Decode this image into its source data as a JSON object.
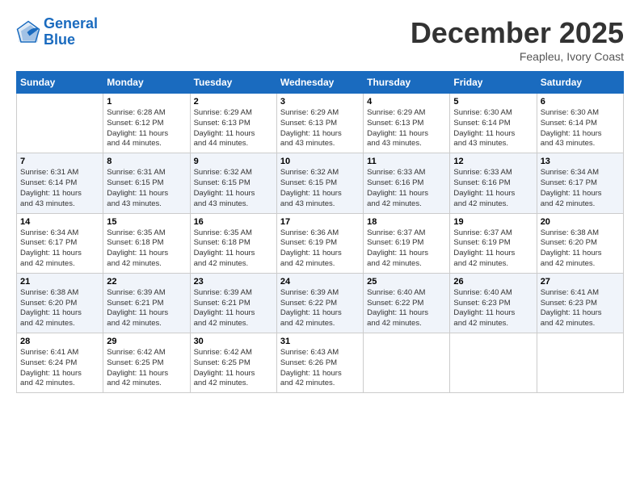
{
  "header": {
    "logo_line1": "General",
    "logo_line2": "Blue",
    "month": "December 2025",
    "location": "Feapleu, Ivory Coast"
  },
  "weekdays": [
    "Sunday",
    "Monday",
    "Tuesday",
    "Wednesday",
    "Thursday",
    "Friday",
    "Saturday"
  ],
  "weeks": [
    [
      {
        "day": "",
        "text": ""
      },
      {
        "day": "1",
        "text": "Sunrise: 6:28 AM\nSunset: 6:12 PM\nDaylight: 11 hours\nand 44 minutes."
      },
      {
        "day": "2",
        "text": "Sunrise: 6:29 AM\nSunset: 6:13 PM\nDaylight: 11 hours\nand 44 minutes."
      },
      {
        "day": "3",
        "text": "Sunrise: 6:29 AM\nSunset: 6:13 PM\nDaylight: 11 hours\nand 43 minutes."
      },
      {
        "day": "4",
        "text": "Sunrise: 6:29 AM\nSunset: 6:13 PM\nDaylight: 11 hours\nand 43 minutes."
      },
      {
        "day": "5",
        "text": "Sunrise: 6:30 AM\nSunset: 6:14 PM\nDaylight: 11 hours\nand 43 minutes."
      },
      {
        "day": "6",
        "text": "Sunrise: 6:30 AM\nSunset: 6:14 PM\nDaylight: 11 hours\nand 43 minutes."
      }
    ],
    [
      {
        "day": "7",
        "text": "Sunrise: 6:31 AM\nSunset: 6:14 PM\nDaylight: 11 hours\nand 43 minutes."
      },
      {
        "day": "8",
        "text": "Sunrise: 6:31 AM\nSunset: 6:15 PM\nDaylight: 11 hours\nand 43 minutes."
      },
      {
        "day": "9",
        "text": "Sunrise: 6:32 AM\nSunset: 6:15 PM\nDaylight: 11 hours\nand 43 minutes."
      },
      {
        "day": "10",
        "text": "Sunrise: 6:32 AM\nSunset: 6:15 PM\nDaylight: 11 hours\nand 43 minutes."
      },
      {
        "day": "11",
        "text": "Sunrise: 6:33 AM\nSunset: 6:16 PM\nDaylight: 11 hours\nand 42 minutes."
      },
      {
        "day": "12",
        "text": "Sunrise: 6:33 AM\nSunset: 6:16 PM\nDaylight: 11 hours\nand 42 minutes."
      },
      {
        "day": "13",
        "text": "Sunrise: 6:34 AM\nSunset: 6:17 PM\nDaylight: 11 hours\nand 42 minutes."
      }
    ],
    [
      {
        "day": "14",
        "text": "Sunrise: 6:34 AM\nSunset: 6:17 PM\nDaylight: 11 hours\nand 42 minutes."
      },
      {
        "day": "15",
        "text": "Sunrise: 6:35 AM\nSunset: 6:18 PM\nDaylight: 11 hours\nand 42 minutes."
      },
      {
        "day": "16",
        "text": "Sunrise: 6:35 AM\nSunset: 6:18 PM\nDaylight: 11 hours\nand 42 minutes."
      },
      {
        "day": "17",
        "text": "Sunrise: 6:36 AM\nSunset: 6:19 PM\nDaylight: 11 hours\nand 42 minutes."
      },
      {
        "day": "18",
        "text": "Sunrise: 6:37 AM\nSunset: 6:19 PM\nDaylight: 11 hours\nand 42 minutes."
      },
      {
        "day": "19",
        "text": "Sunrise: 6:37 AM\nSunset: 6:19 PM\nDaylight: 11 hours\nand 42 minutes."
      },
      {
        "day": "20",
        "text": "Sunrise: 6:38 AM\nSunset: 6:20 PM\nDaylight: 11 hours\nand 42 minutes."
      }
    ],
    [
      {
        "day": "21",
        "text": "Sunrise: 6:38 AM\nSunset: 6:20 PM\nDaylight: 11 hours\nand 42 minutes."
      },
      {
        "day": "22",
        "text": "Sunrise: 6:39 AM\nSunset: 6:21 PM\nDaylight: 11 hours\nand 42 minutes."
      },
      {
        "day": "23",
        "text": "Sunrise: 6:39 AM\nSunset: 6:21 PM\nDaylight: 11 hours\nand 42 minutes."
      },
      {
        "day": "24",
        "text": "Sunrise: 6:39 AM\nSunset: 6:22 PM\nDaylight: 11 hours\nand 42 minutes."
      },
      {
        "day": "25",
        "text": "Sunrise: 6:40 AM\nSunset: 6:22 PM\nDaylight: 11 hours\nand 42 minutes."
      },
      {
        "day": "26",
        "text": "Sunrise: 6:40 AM\nSunset: 6:23 PM\nDaylight: 11 hours\nand 42 minutes."
      },
      {
        "day": "27",
        "text": "Sunrise: 6:41 AM\nSunset: 6:23 PM\nDaylight: 11 hours\nand 42 minutes."
      }
    ],
    [
      {
        "day": "28",
        "text": "Sunrise: 6:41 AM\nSunset: 6:24 PM\nDaylight: 11 hours\nand 42 minutes."
      },
      {
        "day": "29",
        "text": "Sunrise: 6:42 AM\nSunset: 6:25 PM\nDaylight: 11 hours\nand 42 minutes."
      },
      {
        "day": "30",
        "text": "Sunrise: 6:42 AM\nSunset: 6:25 PM\nDaylight: 11 hours\nand 42 minutes."
      },
      {
        "day": "31",
        "text": "Sunrise: 6:43 AM\nSunset: 6:26 PM\nDaylight: 11 hours\nand 42 minutes."
      },
      {
        "day": "",
        "text": ""
      },
      {
        "day": "",
        "text": ""
      },
      {
        "day": "",
        "text": ""
      }
    ]
  ]
}
